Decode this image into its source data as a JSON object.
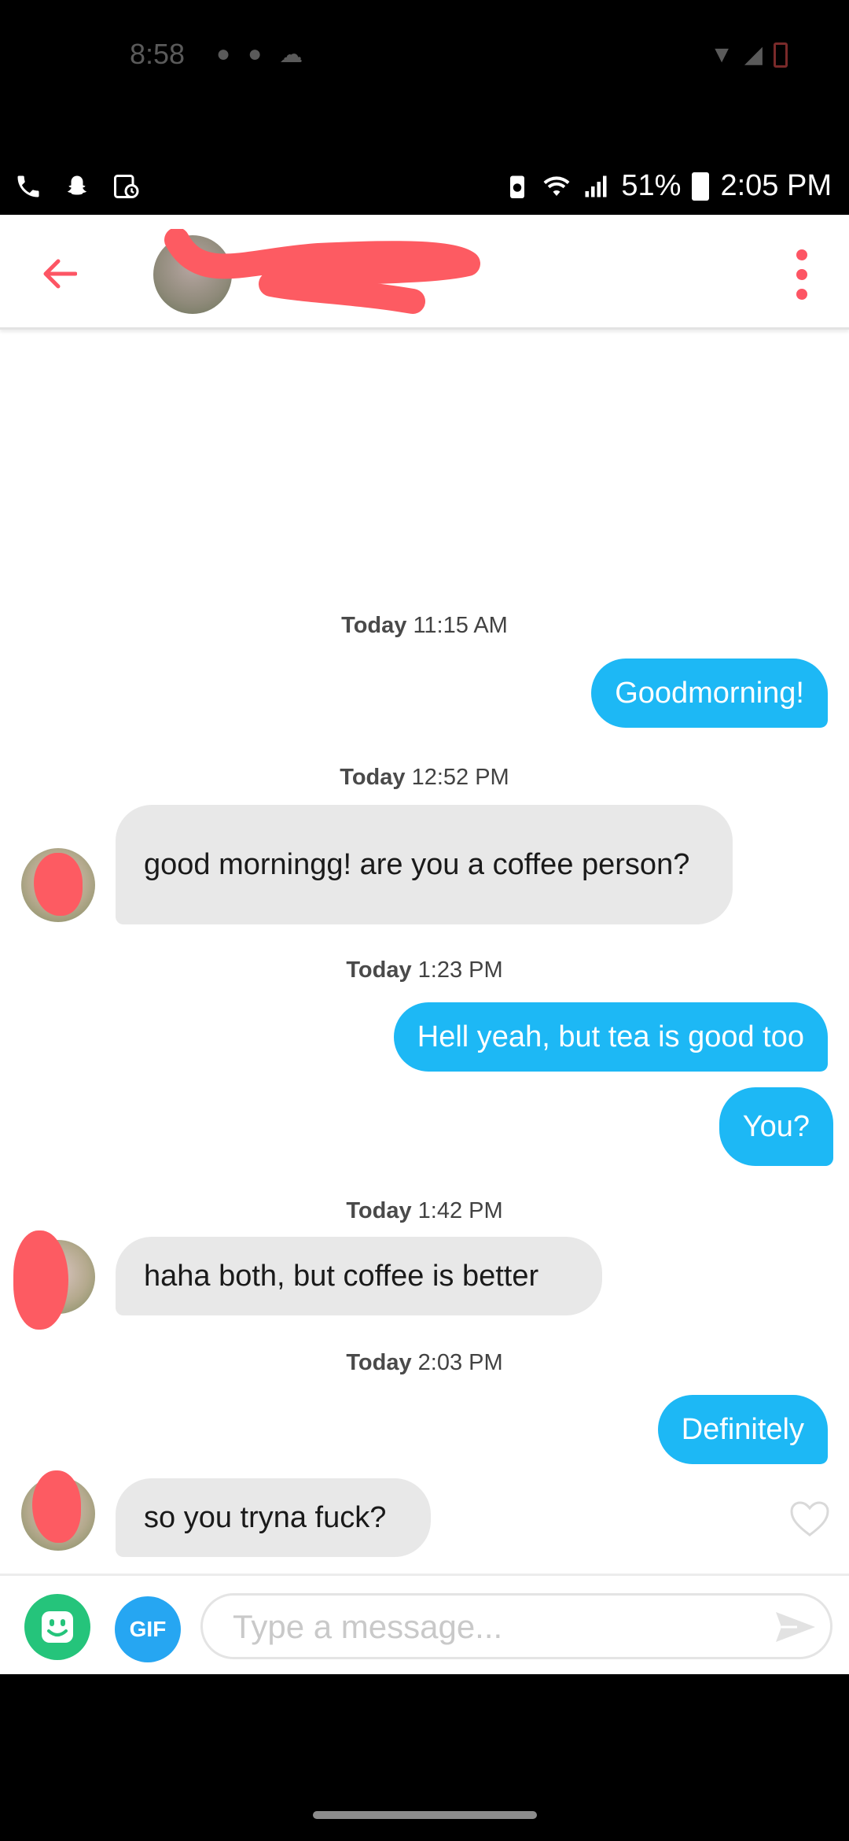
{
  "overlay_status": {
    "time": "8:58"
  },
  "status_bar": {
    "battery": "51%",
    "time": "2:05 PM"
  },
  "composer": {
    "gif_label": "GIF",
    "placeholder": "Type a message..."
  },
  "messages": [
    {
      "type": "timestamp",
      "day": "Today",
      "time": "11:15 AM"
    },
    {
      "type": "outgoing",
      "text": "Goodmorning!"
    },
    {
      "type": "timestamp",
      "day": "Today",
      "time": "12:52 PM"
    },
    {
      "type": "incoming",
      "text": "good morningg! are you a coffee person?"
    },
    {
      "type": "timestamp",
      "day": "Today",
      "time": "1:23 PM"
    },
    {
      "type": "outgoing",
      "text": "Hell yeah, but tea is good too"
    },
    {
      "type": "outgoing",
      "text": "You?"
    },
    {
      "type": "timestamp",
      "day": "Today",
      "time": "1:42 PM"
    },
    {
      "type": "incoming",
      "text": "haha both, but coffee is better"
    },
    {
      "type": "timestamp",
      "day": "Today",
      "time": "2:03 PM"
    },
    {
      "type": "outgoing",
      "text": "Definitely"
    },
    {
      "type": "incoming",
      "text": "so you tryna fuck?"
    }
  ],
  "colors": {
    "accent": "#fd5564",
    "outgoing_bubble": "#1db8f5",
    "incoming_bubble": "#e8e8e8",
    "sticker_button": "#25c47b",
    "gif_button": "#26a6f2"
  }
}
